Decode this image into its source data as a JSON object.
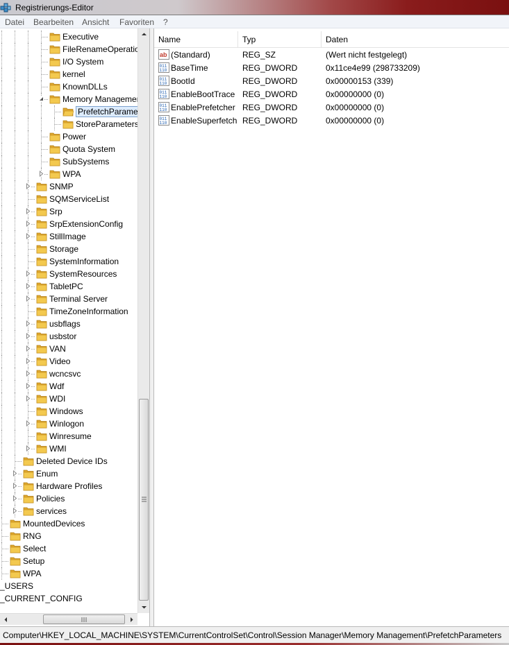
{
  "window": {
    "title": "Registrierungs-Editor"
  },
  "menu": [
    "Datei",
    "Bearbeiten",
    "Ansicht",
    "Favoriten",
    "?"
  ],
  "tree": [
    {
      "label": "Executive",
      "level": 3,
      "expander": "none"
    },
    {
      "label": "FileRenameOperations",
      "level": 3,
      "expander": "none"
    },
    {
      "label": "I/O System",
      "level": 3,
      "expander": "none"
    },
    {
      "label": "kernel",
      "level": 3,
      "expander": "none"
    },
    {
      "label": "KnownDLLs",
      "level": 3,
      "expander": "none"
    },
    {
      "label": "Memory Management",
      "level": 3,
      "expander": "expanded"
    },
    {
      "label": "PrefetchParameters",
      "level": 4,
      "expander": "none",
      "selected": true,
      "open_folder": true
    },
    {
      "label": "StoreParameters",
      "level": 4,
      "expander": "none"
    },
    {
      "label": "Power",
      "level": 3,
      "expander": "none"
    },
    {
      "label": "Quota System",
      "level": 3,
      "expander": "none"
    },
    {
      "label": "SubSystems",
      "level": 3,
      "expander": "none"
    },
    {
      "label": "WPA",
      "level": 3,
      "expander": "collapsed"
    },
    {
      "label": "SNMP",
      "level": 2,
      "expander": "collapsed"
    },
    {
      "label": "SQMServiceList",
      "level": 2,
      "expander": "none"
    },
    {
      "label": "Srp",
      "level": 2,
      "expander": "collapsed"
    },
    {
      "label": "SrpExtensionConfig",
      "level": 2,
      "expander": "collapsed"
    },
    {
      "label": "StillImage",
      "level": 2,
      "expander": "collapsed"
    },
    {
      "label": "Storage",
      "level": 2,
      "expander": "none"
    },
    {
      "label": "SystemInformation",
      "level": 2,
      "expander": "none"
    },
    {
      "label": "SystemResources",
      "level": 2,
      "expander": "collapsed"
    },
    {
      "label": "TabletPC",
      "level": 2,
      "expander": "collapsed"
    },
    {
      "label": "Terminal Server",
      "level": 2,
      "expander": "collapsed"
    },
    {
      "label": "TimeZoneInformation",
      "level": 2,
      "expander": "none"
    },
    {
      "label": "usbflags",
      "level": 2,
      "expander": "collapsed"
    },
    {
      "label": "usbstor",
      "level": 2,
      "expander": "collapsed"
    },
    {
      "label": "VAN",
      "level": 2,
      "expander": "collapsed"
    },
    {
      "label": "Video",
      "level": 2,
      "expander": "collapsed"
    },
    {
      "label": "wcncsvc",
      "level": 2,
      "expander": "collapsed"
    },
    {
      "label": "Wdf",
      "level": 2,
      "expander": "collapsed"
    },
    {
      "label": "WDI",
      "level": 2,
      "expander": "collapsed"
    },
    {
      "label": "Windows",
      "level": 2,
      "expander": "none"
    },
    {
      "label": "Winlogon",
      "level": 2,
      "expander": "collapsed"
    },
    {
      "label": "Winresume",
      "level": 2,
      "expander": "none"
    },
    {
      "label": "WMI",
      "level": 2,
      "expander": "collapsed"
    },
    {
      "label": "Deleted Device IDs",
      "level": 1,
      "expander": "none"
    },
    {
      "label": "Enum",
      "level": 1,
      "expander": "collapsed"
    },
    {
      "label": "Hardware Profiles",
      "level": 1,
      "expander": "collapsed"
    },
    {
      "label": "Policies",
      "level": 1,
      "expander": "collapsed"
    },
    {
      "label": "services",
      "level": 1,
      "expander": "collapsed"
    },
    {
      "label": "MountedDevices",
      "level": 0,
      "expander": "none"
    },
    {
      "label": "RNG",
      "level": 0,
      "expander": "none"
    },
    {
      "label": "Select",
      "level": 0,
      "expander": "none"
    },
    {
      "label": "Setup",
      "level": 0,
      "expander": "none"
    },
    {
      "label": "WPA",
      "level": 0,
      "expander": "none"
    },
    {
      "label": "_USERS",
      "level": -1,
      "expander": "none",
      "no_folder": true
    },
    {
      "label": "_CURRENT_CONFIG",
      "level": -1,
      "expander": "none",
      "no_folder": true
    }
  ],
  "list": {
    "columns": [
      "Name",
      "Typ",
      "Daten"
    ],
    "rows": [
      {
        "icon": "string-value-icon",
        "name": "(Standard)",
        "type": "REG_SZ",
        "data": "(Wert nicht festgelegt)"
      },
      {
        "icon": "binary-value-icon",
        "name": "BaseTime",
        "type": "REG_DWORD",
        "data": "0x11ce4e99 (298733209)"
      },
      {
        "icon": "binary-value-icon",
        "name": "BootId",
        "type": "REG_DWORD",
        "data": "0x00000153 (339)"
      },
      {
        "icon": "binary-value-icon",
        "name": "EnableBootTrace",
        "type": "REG_DWORD",
        "data": "0x00000000 (0)"
      },
      {
        "icon": "binary-value-icon",
        "name": "EnablePrefetcher",
        "type": "REG_DWORD",
        "data": "0x00000000 (0)"
      },
      {
        "icon": "binary-value-icon",
        "name": "EnableSuperfetch",
        "type": "REG_DWORD",
        "data": "0x00000000 (0)"
      }
    ]
  },
  "status": {
    "path": "Computer\\HKEY_LOCAL_MACHINE\\SYSTEM\\CurrentControlSet\\Control\\Session Manager\\Memory Management\\PrefetchParameters"
  },
  "colors": {
    "folder": "#f3c94f",
    "selection": "#dcebfc",
    "title_accent": "#8a1c1c"
  }
}
